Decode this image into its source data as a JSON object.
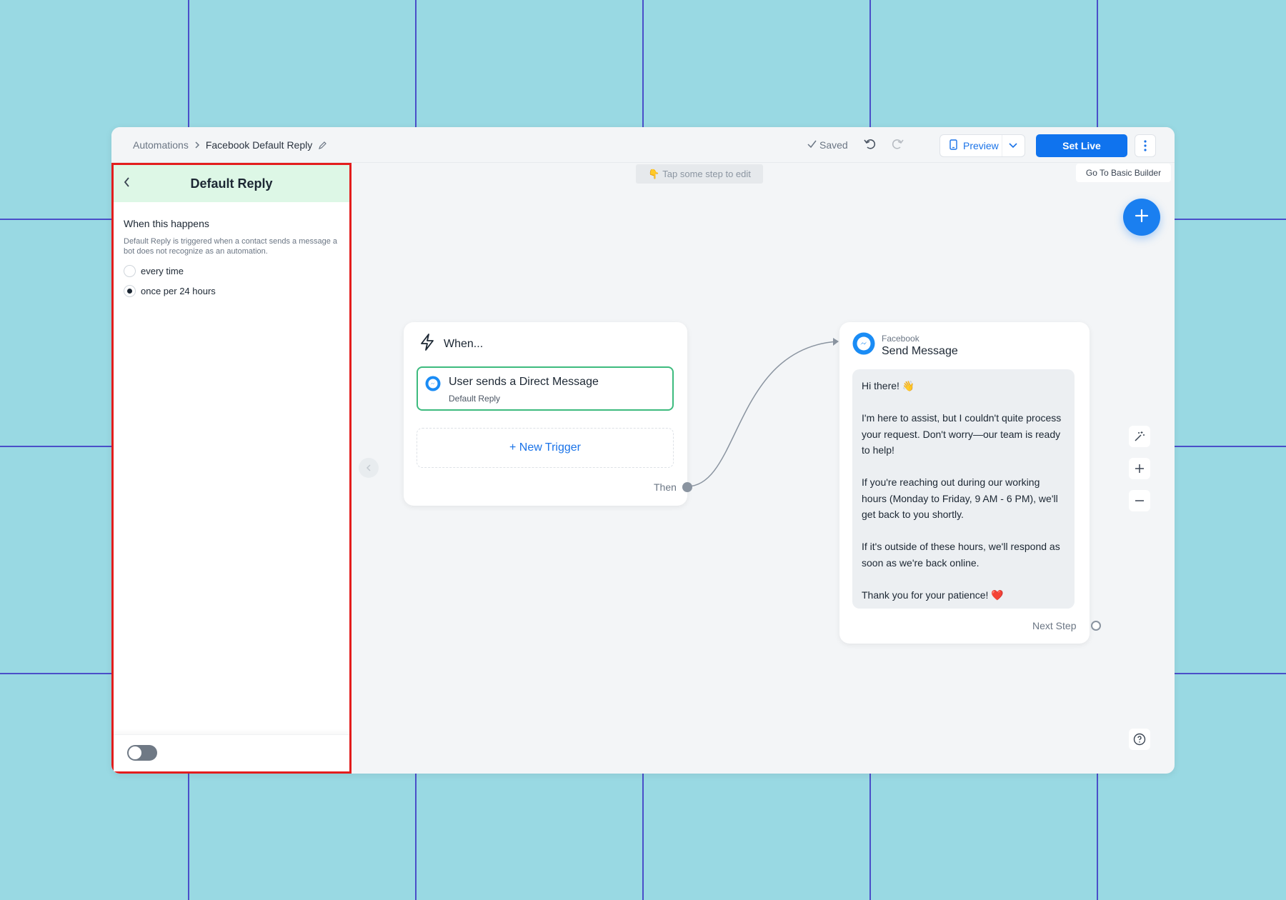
{
  "breadcrumb": {
    "root": "Automations",
    "current": "Facebook Default Reply"
  },
  "toolbar": {
    "saved_label": "Saved",
    "preview_label": "Preview",
    "set_live_label": "Set Live",
    "basic_builder_label": "Go To Basic Builder"
  },
  "canvas": {
    "hint": "Tap some step to edit"
  },
  "sidebar": {
    "title": "Default Reply",
    "section_title": "When this happens",
    "description": "Default Reply is triggered when a contact sends a message a bot does not recognize as an automation.",
    "options": [
      {
        "label": "every time",
        "selected": false
      },
      {
        "label": "once per 24 hours",
        "selected": true
      }
    ],
    "toggle_on": false
  },
  "when_card": {
    "title": "When...",
    "trigger_title": "User sends a Direct Message",
    "trigger_sub": "Default Reply",
    "new_trigger": "+ New Trigger",
    "then_label": "Then"
  },
  "send_card": {
    "channel": "Facebook",
    "title": "Send Message",
    "message": [
      "Hi there! 👋",
      "I'm here to assist, but I couldn't quite process your request. Don't worry—our team is ready to help!",
      "If you're reaching out during our working hours (Monday to Friday, 9 AM - 6 PM), we'll get back to you shortly.",
      "If it's outside of these hours, we'll respond as soon as we're back online.",
      "Thank you for your patience! ❤️"
    ],
    "next_step_label": "Next Step"
  },
  "colors": {
    "accent": "#0f73ee",
    "trigger_border": "#3dbb7e",
    "sidebar_header": "#ddf7e6",
    "highlight": "#e31d1d",
    "background": "#99d9e3"
  },
  "icons": [
    "chevron-right-icon",
    "pencil-icon",
    "check-icon",
    "undo-icon",
    "redo-icon",
    "phone-icon",
    "chevron-down-icon",
    "kebab-icon",
    "plus-icon",
    "back-chevron-icon",
    "lightning-icon",
    "messenger-icon",
    "magic-wand-icon",
    "zoom-in-icon",
    "zoom-out-icon",
    "help-icon"
  ]
}
